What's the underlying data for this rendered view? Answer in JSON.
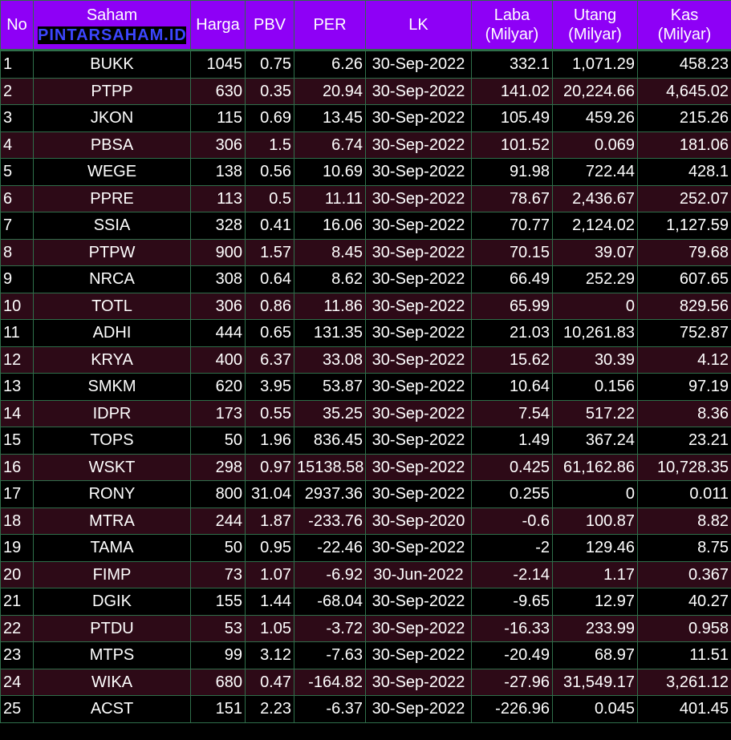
{
  "headers": {
    "no": "No",
    "saham": "Saham",
    "brand": "PINTARSAHAM.ID",
    "harga": "Harga",
    "pbv": "PBV",
    "per": "PER",
    "lk": "LK",
    "laba_1": "Laba",
    "laba_2": "(Milyar)",
    "utang_1": "Utang",
    "utang_2": "(Milyar)",
    "kas_1": "Kas",
    "kas_2": "(Milyar)"
  },
  "rows": [
    [
      "1",
      "BUKK",
      "1045",
      "0.75",
      "6.26",
      "30-Sep-2022",
      "332.1",
      "1,071.29",
      "458.23"
    ],
    [
      "2",
      "PTPP",
      "630",
      "0.35",
      "20.94",
      "30-Sep-2022",
      "141.02",
      "20,224.66",
      "4,645.02"
    ],
    [
      "3",
      "JKON",
      "115",
      "0.69",
      "13.45",
      "30-Sep-2022",
      "105.49",
      "459.26",
      "215.26"
    ],
    [
      "4",
      "PBSA",
      "306",
      "1.5",
      "6.74",
      "30-Sep-2022",
      "101.52",
      "0.069",
      "181.06"
    ],
    [
      "5",
      "WEGE",
      "138",
      "0.56",
      "10.69",
      "30-Sep-2022",
      "91.98",
      "722.44",
      "428.1"
    ],
    [
      "6",
      "PPRE",
      "113",
      "0.5",
      "11.11",
      "30-Sep-2022",
      "78.67",
      "2,436.67",
      "252.07"
    ],
    [
      "7",
      "SSIA",
      "328",
      "0.41",
      "16.06",
      "30-Sep-2022",
      "70.77",
      "2,124.02",
      "1,127.59"
    ],
    [
      "8",
      "PTPW",
      "900",
      "1.57",
      "8.45",
      "30-Sep-2022",
      "70.15",
      "39.07",
      "79.68"
    ],
    [
      "9",
      "NRCA",
      "308",
      "0.64",
      "8.62",
      "30-Sep-2022",
      "66.49",
      "252.29",
      "607.65"
    ],
    [
      "10",
      "TOTL",
      "306",
      "0.86",
      "11.86",
      "30-Sep-2022",
      "65.99",
      "0",
      "829.56"
    ],
    [
      "11",
      "ADHI",
      "444",
      "0.65",
      "131.35",
      "30-Sep-2022",
      "21.03",
      "10,261.83",
      "752.87"
    ],
    [
      "12",
      "KRYA",
      "400",
      "6.37",
      "33.08",
      "30-Sep-2022",
      "15.62",
      "30.39",
      "4.12"
    ],
    [
      "13",
      "SMKM",
      "620",
      "3.95",
      "53.87",
      "30-Sep-2022",
      "10.64",
      "0.156",
      "97.19"
    ],
    [
      "14",
      "IDPR",
      "173",
      "0.55",
      "35.25",
      "30-Sep-2022",
      "7.54",
      "517.22",
      "8.36"
    ],
    [
      "15",
      "TOPS",
      "50",
      "1.96",
      "836.45",
      "30-Sep-2022",
      "1.49",
      "367.24",
      "23.21"
    ],
    [
      "16",
      "WSKT",
      "298",
      "0.97",
      "15138.58",
      "30-Sep-2022",
      "0.425",
      "61,162.86",
      "10,728.35"
    ],
    [
      "17",
      "RONY",
      "800",
      "31.04",
      "2937.36",
      "30-Sep-2022",
      "0.255",
      "0",
      "0.011"
    ],
    [
      "18",
      "MTRA",
      "244",
      "1.87",
      "-233.76",
      "30-Sep-2020",
      "-0.6",
      "100.87",
      "8.82"
    ],
    [
      "19",
      "TAMA",
      "50",
      "0.95",
      "-22.46",
      "30-Sep-2022",
      "-2",
      "129.46",
      "8.75"
    ],
    [
      "20",
      "FIMP",
      "73",
      "1.07",
      "-6.92",
      "30-Jun-2022",
      "-2.14",
      "1.17",
      "0.367"
    ],
    [
      "21",
      "DGIK",
      "155",
      "1.44",
      "-68.04",
      "30-Sep-2022",
      "-9.65",
      "12.97",
      "40.27"
    ],
    [
      "22",
      "PTDU",
      "53",
      "1.05",
      "-3.72",
      "30-Sep-2022",
      "-16.33",
      "233.99",
      "0.958"
    ],
    [
      "23",
      "MTPS",
      "99",
      "3.12",
      "-7.63",
      "30-Sep-2022",
      "-20.49",
      "68.97",
      "11.51"
    ],
    [
      "24",
      "WIKA",
      "680",
      "0.47",
      "-164.82",
      "30-Sep-2022",
      "-27.96",
      "31,549.17",
      "3,261.12"
    ],
    [
      "25",
      "ACST",
      "151",
      "2.23",
      "-6.37",
      "30-Sep-2022",
      "-226.96",
      "0.045",
      "401.45"
    ]
  ]
}
